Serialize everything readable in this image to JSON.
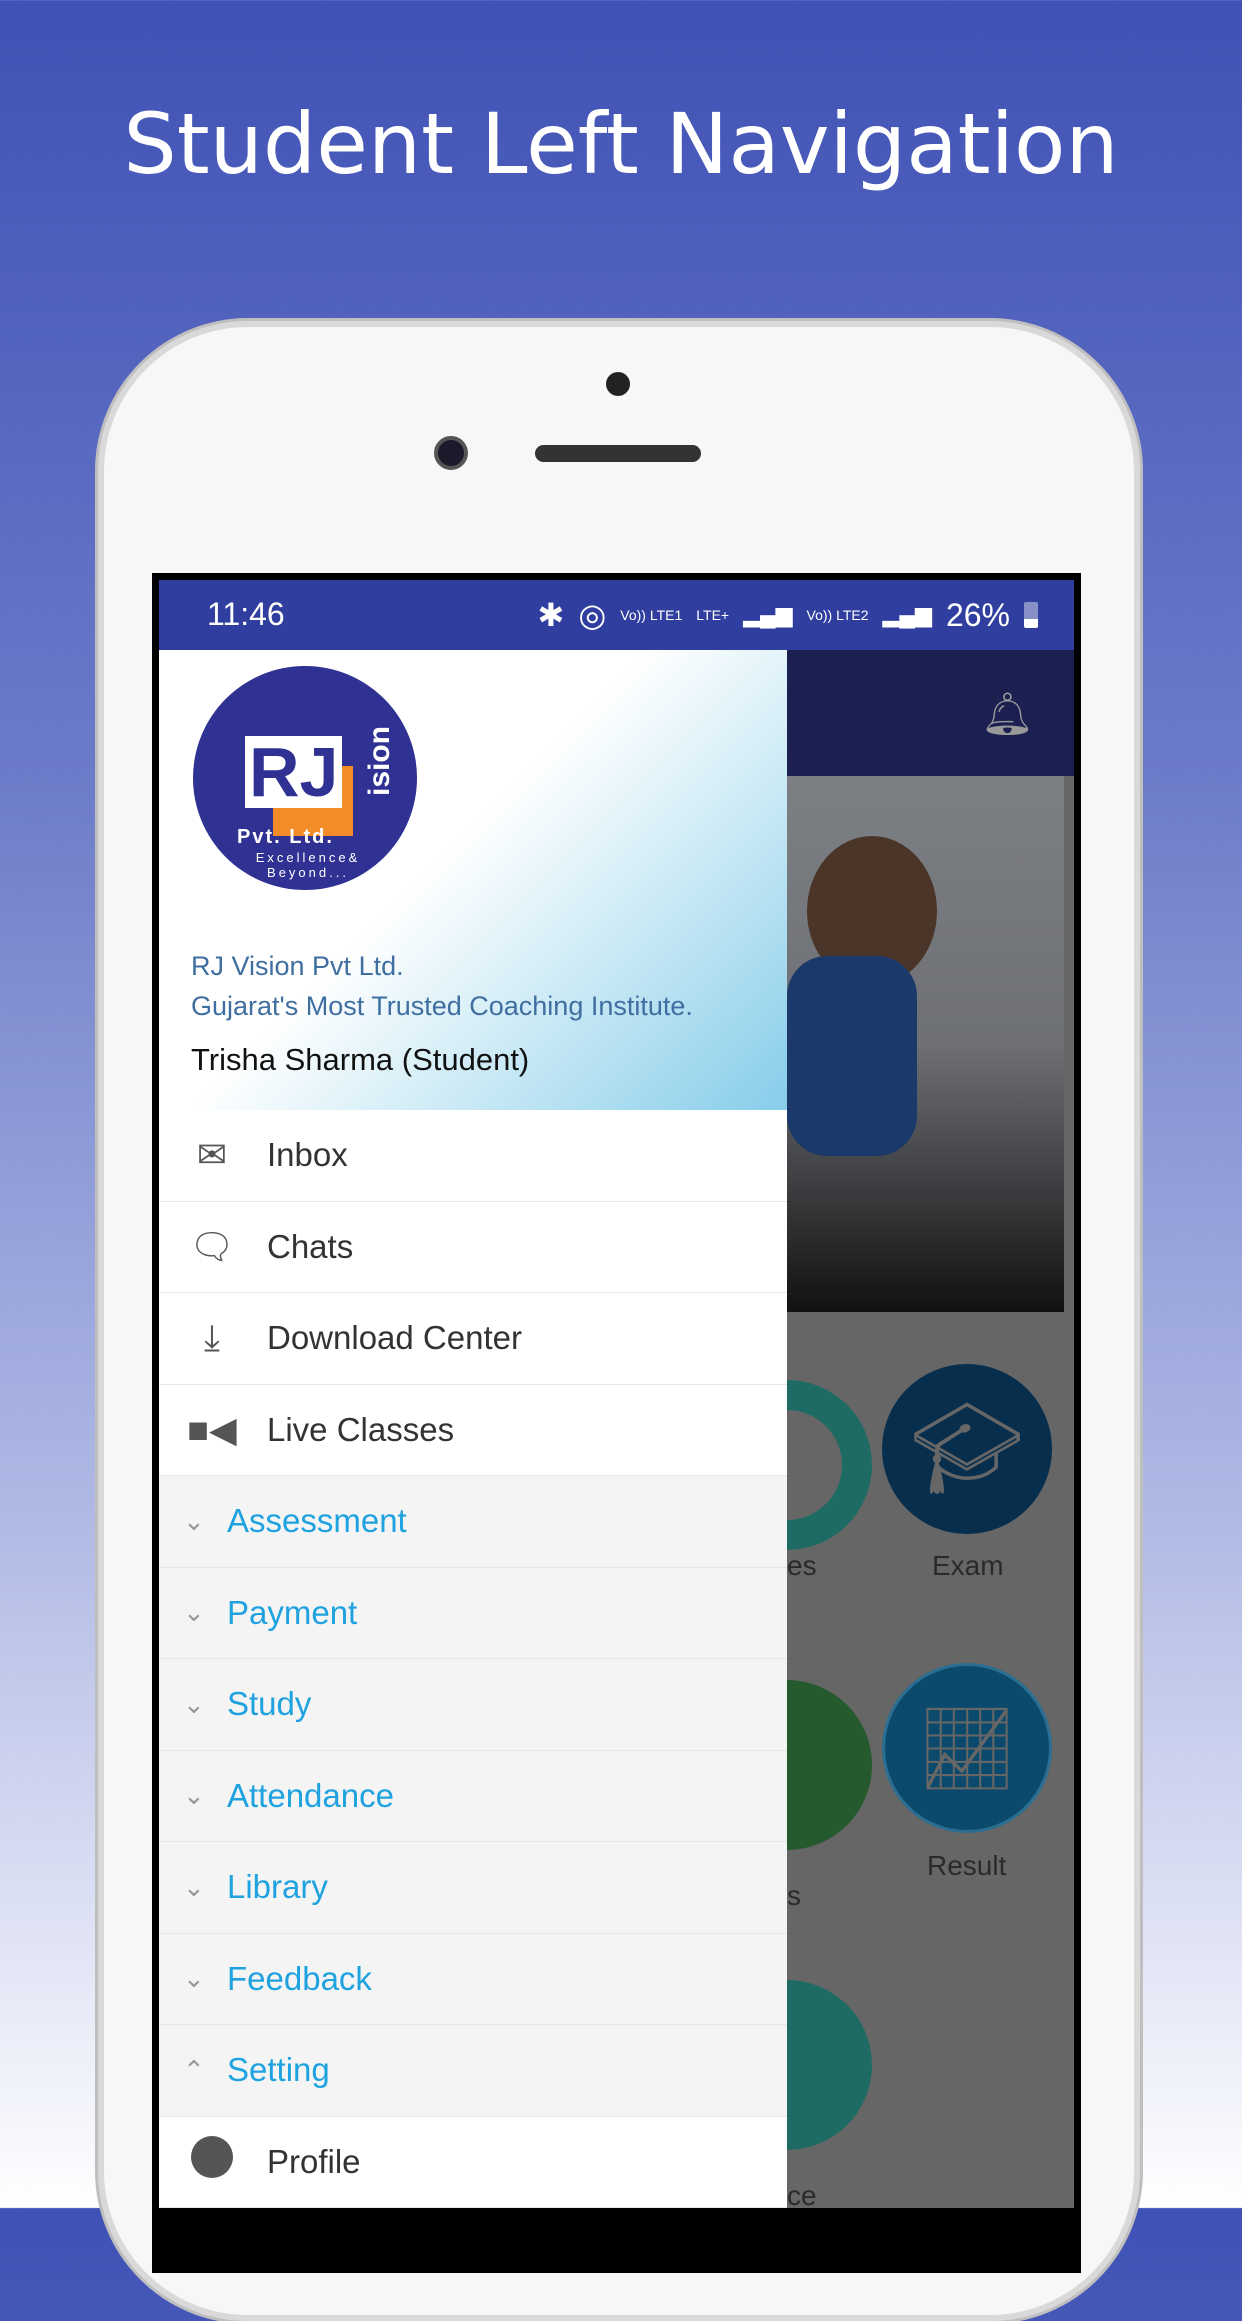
{
  "page_title": "Student Left Navigation",
  "status_bar": {
    "time": "11:46",
    "indicators": [
      "bluetooth-icon",
      "hotspot-icon",
      "Vo)) LTE1",
      "LTE+",
      "signal-icon",
      "Vo)) LTE2",
      "signal-icon"
    ],
    "battery": "26%"
  },
  "drawer": {
    "logo_text": {
      "name": "RJ",
      "vision": "Vision",
      "pvt": "Pvt. Ltd.",
      "tagline": "Excellence& Beyond..."
    },
    "org_name": "RJ Vision Pvt Ltd.",
    "org_tagline": "Gujarat's Most Trusted Coaching Institute.",
    "user": "Trisha Sharma (Student)",
    "items": [
      {
        "label": "Inbox",
        "icon": "mail-icon"
      },
      {
        "label": "Chats",
        "icon": "chat-bubble-icon"
      },
      {
        "label": "Download Center",
        "icon": "download-icon"
      },
      {
        "label": "Live Classes",
        "icon": "video-camera-icon"
      }
    ],
    "groups": [
      {
        "label": "Assessment",
        "expanded": false
      },
      {
        "label": "Payment",
        "expanded": false
      },
      {
        "label": "Study",
        "expanded": false
      },
      {
        "label": "Attendance",
        "expanded": false
      },
      {
        "label": "Library",
        "expanded": false
      },
      {
        "label": "Feedback",
        "expanded": false
      },
      {
        "label": "Setting",
        "expanded": true
      }
    ],
    "sub_items": [
      {
        "label": "Profile",
        "icon": "account-circle-icon"
      }
    ]
  },
  "background_app": {
    "grid": [
      {
        "label": "es"
      },
      {
        "label": "Exam"
      },
      {
        "label": "s"
      },
      {
        "label": "Result"
      },
      {
        "label": "ce"
      }
    ]
  },
  "colors": {
    "status_bar": "#303f9f",
    "group_text": "#1fa2e0",
    "org_text": "#3f6ea0"
  }
}
